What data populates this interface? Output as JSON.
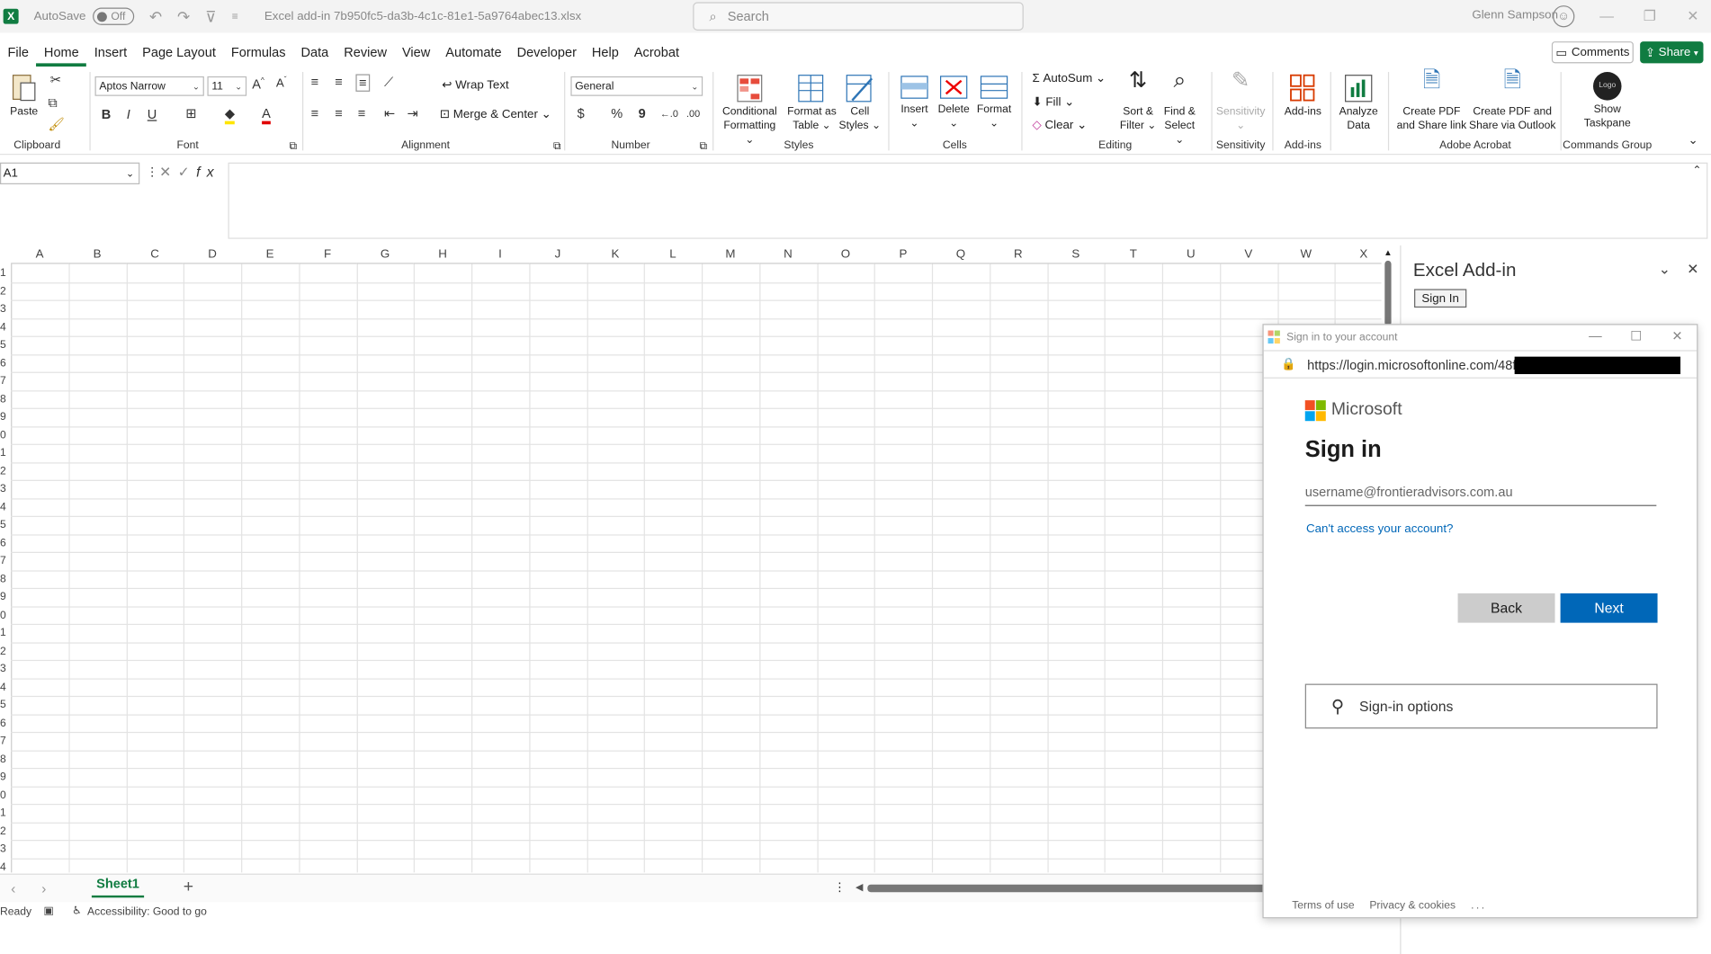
{
  "titlebar": {
    "autosave_label": "AutoSave",
    "autosave_state": "Off",
    "filename": "Excel add-in 7b950fc5-da3b-4c1c-81e1-5a9764abec13.xlsx",
    "search_placeholder": "Search",
    "user_name": "Glenn Sampson"
  },
  "tabs": [
    "File",
    "Home",
    "Insert",
    "Page Layout",
    "Formulas",
    "Data",
    "Review",
    "View",
    "Automate",
    "Developer",
    "Help",
    "Acrobat"
  ],
  "active_tab": "Home",
  "comments_label": "Comments",
  "share_label": "Share",
  "ribbon": {
    "paste": "Paste",
    "font_name": "Aptos Narrow",
    "font_size": "11",
    "wrap_text": "Wrap Text",
    "merge_center": "Merge & Center",
    "number_format": "General",
    "conditional_formatting": [
      "Conditional",
      "Formatting"
    ],
    "format_as_table": [
      "Format as",
      "Table"
    ],
    "cell_styles": [
      "Cell",
      "Styles"
    ],
    "insert": "Insert",
    "delete": "Delete",
    "format": "Format",
    "autosum": "AutoSum",
    "fill": "Fill",
    "clear": "Clear",
    "sort_filter": [
      "Sort &",
      "Filter"
    ],
    "find_select": [
      "Find &",
      "Select"
    ],
    "sensitivity": "Sensitivity",
    "addins": "Add-ins",
    "analyze_data": [
      "Analyze",
      "Data"
    ],
    "create_pdf_share": [
      "Create PDF",
      "and Share link"
    ],
    "create_pdf_outlook": [
      "Create PDF and",
      "Share via Outlook"
    ],
    "show_taskpane": [
      "Show",
      "Taskpane"
    ],
    "logo_text": "Logo",
    "groups": {
      "clipboard": "Clipboard",
      "font": "Font",
      "alignment": "Alignment",
      "number": "Number",
      "styles": "Styles",
      "cells": "Cells",
      "editing": "Editing",
      "sensitivity": "Sensitivity",
      "addins": "Add-ins",
      "adobe": "Adobe Acrobat",
      "commands": "Commands Group"
    }
  },
  "formula_bar": {
    "name_box": "A1",
    "fx": "fx"
  },
  "columns": [
    "A",
    "B",
    "C",
    "D",
    "E",
    "F",
    "G",
    "H",
    "I",
    "J",
    "K",
    "L",
    "M",
    "N",
    "O",
    "P",
    "Q",
    "R",
    "S",
    "T",
    "U",
    "V",
    "W",
    "X"
  ],
  "row_digits": [
    "1",
    "2",
    "3",
    "4",
    "5",
    "6",
    "7",
    "8",
    "9",
    "0",
    "1",
    "2",
    "3",
    "4",
    "5",
    "6",
    "7",
    "8",
    "9",
    "0",
    "1",
    "2",
    "3",
    "4",
    "5",
    "6",
    "7",
    "8",
    "9",
    "0",
    "1",
    "2",
    "3",
    "4"
  ],
  "sheet_tab": "Sheet1",
  "status": {
    "ready": "Ready",
    "accessibility": "Accessibility: Good to go"
  },
  "taskpane": {
    "title": "Excel Add-in",
    "signin_button": "Sign In"
  },
  "dialog": {
    "window_title": "Sign in to your account",
    "url": "https://login.microsoftonline.com/48f",
    "brand": "Microsoft",
    "heading": "Sign in",
    "email_placeholder": "username@frontieradvisors.com.au",
    "cant_access": "Can't access your account?",
    "back": "Back",
    "next": "Next",
    "signin_options": "Sign-in options",
    "terms": "Terms of use",
    "privacy": "Privacy & cookies",
    "more": "..."
  },
  "colors": {
    "excel_green": "#107c41",
    "ms_blue": "#0067b8",
    "ms_red": "#f25022",
    "ms_green": "#7fba00",
    "ms_blue_logo": "#00a4ef",
    "ms_yellow": "#ffb900"
  }
}
